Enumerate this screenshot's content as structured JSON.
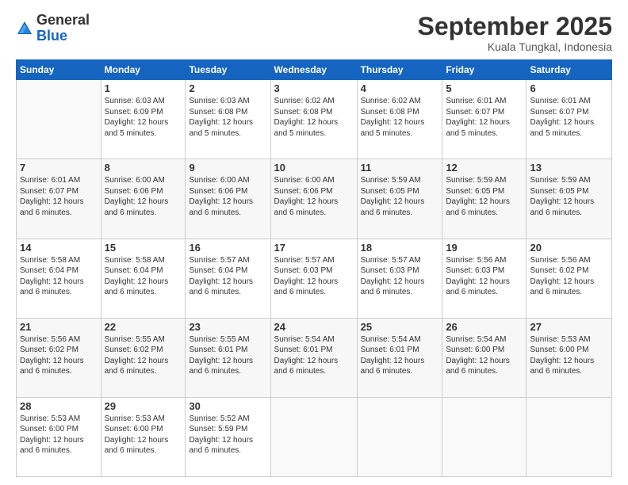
{
  "logo": {
    "general": "General",
    "blue": "Blue"
  },
  "header": {
    "month": "September 2025",
    "location": "Kuala Tungkal, Indonesia"
  },
  "days_of_week": [
    "Sunday",
    "Monday",
    "Tuesday",
    "Wednesday",
    "Thursday",
    "Friday",
    "Saturday"
  ],
  "weeks": [
    [
      {
        "day": "",
        "info": ""
      },
      {
        "day": "1",
        "info": "Sunrise: 6:03 AM\nSunset: 6:09 PM\nDaylight: 12 hours\nand 5 minutes."
      },
      {
        "day": "2",
        "info": "Sunrise: 6:03 AM\nSunset: 6:08 PM\nDaylight: 12 hours\nand 5 minutes."
      },
      {
        "day": "3",
        "info": "Sunrise: 6:02 AM\nSunset: 6:08 PM\nDaylight: 12 hours\nand 5 minutes."
      },
      {
        "day": "4",
        "info": "Sunrise: 6:02 AM\nSunset: 6:08 PM\nDaylight: 12 hours\nand 5 minutes."
      },
      {
        "day": "5",
        "info": "Sunrise: 6:01 AM\nSunset: 6:07 PM\nDaylight: 12 hours\nand 5 minutes."
      },
      {
        "day": "6",
        "info": "Sunrise: 6:01 AM\nSunset: 6:07 PM\nDaylight: 12 hours\nand 5 minutes."
      }
    ],
    [
      {
        "day": "7",
        "info": "Sunrise: 6:01 AM\nSunset: 6:07 PM\nDaylight: 12 hours\nand 6 minutes."
      },
      {
        "day": "8",
        "info": "Sunrise: 6:00 AM\nSunset: 6:06 PM\nDaylight: 12 hours\nand 6 minutes."
      },
      {
        "day": "9",
        "info": "Sunrise: 6:00 AM\nSunset: 6:06 PM\nDaylight: 12 hours\nand 6 minutes."
      },
      {
        "day": "10",
        "info": "Sunrise: 6:00 AM\nSunset: 6:06 PM\nDaylight: 12 hours\nand 6 minutes."
      },
      {
        "day": "11",
        "info": "Sunrise: 5:59 AM\nSunset: 6:05 PM\nDaylight: 12 hours\nand 6 minutes."
      },
      {
        "day": "12",
        "info": "Sunrise: 5:59 AM\nSunset: 6:05 PM\nDaylight: 12 hours\nand 6 minutes."
      },
      {
        "day": "13",
        "info": "Sunrise: 5:59 AM\nSunset: 6:05 PM\nDaylight: 12 hours\nand 6 minutes."
      }
    ],
    [
      {
        "day": "14",
        "info": "Sunrise: 5:58 AM\nSunset: 6:04 PM\nDaylight: 12 hours\nand 6 minutes."
      },
      {
        "day": "15",
        "info": "Sunrise: 5:58 AM\nSunset: 6:04 PM\nDaylight: 12 hours\nand 6 minutes."
      },
      {
        "day": "16",
        "info": "Sunrise: 5:57 AM\nSunset: 6:04 PM\nDaylight: 12 hours\nand 6 minutes."
      },
      {
        "day": "17",
        "info": "Sunrise: 5:57 AM\nSunset: 6:03 PM\nDaylight: 12 hours\nand 6 minutes."
      },
      {
        "day": "18",
        "info": "Sunrise: 5:57 AM\nSunset: 6:03 PM\nDaylight: 12 hours\nand 6 minutes."
      },
      {
        "day": "19",
        "info": "Sunrise: 5:56 AM\nSunset: 6:03 PM\nDaylight: 12 hours\nand 6 minutes."
      },
      {
        "day": "20",
        "info": "Sunrise: 5:56 AM\nSunset: 6:02 PM\nDaylight: 12 hours\nand 6 minutes."
      }
    ],
    [
      {
        "day": "21",
        "info": "Sunrise: 5:56 AM\nSunset: 6:02 PM\nDaylight: 12 hours\nand 6 minutes."
      },
      {
        "day": "22",
        "info": "Sunrise: 5:55 AM\nSunset: 6:02 PM\nDaylight: 12 hours\nand 6 minutes."
      },
      {
        "day": "23",
        "info": "Sunrise: 5:55 AM\nSunset: 6:01 PM\nDaylight: 12 hours\nand 6 minutes."
      },
      {
        "day": "24",
        "info": "Sunrise: 5:54 AM\nSunset: 6:01 PM\nDaylight: 12 hours\nand 6 minutes."
      },
      {
        "day": "25",
        "info": "Sunrise: 5:54 AM\nSunset: 6:01 PM\nDaylight: 12 hours\nand 6 minutes."
      },
      {
        "day": "26",
        "info": "Sunrise: 5:54 AM\nSunset: 6:00 PM\nDaylight: 12 hours\nand 6 minutes."
      },
      {
        "day": "27",
        "info": "Sunrise: 5:53 AM\nSunset: 6:00 PM\nDaylight: 12 hours\nand 6 minutes."
      }
    ],
    [
      {
        "day": "28",
        "info": "Sunrise: 5:53 AM\nSunset: 6:00 PM\nDaylight: 12 hours\nand 6 minutes."
      },
      {
        "day": "29",
        "info": "Sunrise: 5:53 AM\nSunset: 6:00 PM\nDaylight: 12 hours\nand 6 minutes."
      },
      {
        "day": "30",
        "info": "Sunrise: 5:52 AM\nSunset: 5:59 PM\nDaylight: 12 hours\nand 6 minutes."
      },
      {
        "day": "",
        "info": ""
      },
      {
        "day": "",
        "info": ""
      },
      {
        "day": "",
        "info": ""
      },
      {
        "day": "",
        "info": ""
      }
    ]
  ]
}
